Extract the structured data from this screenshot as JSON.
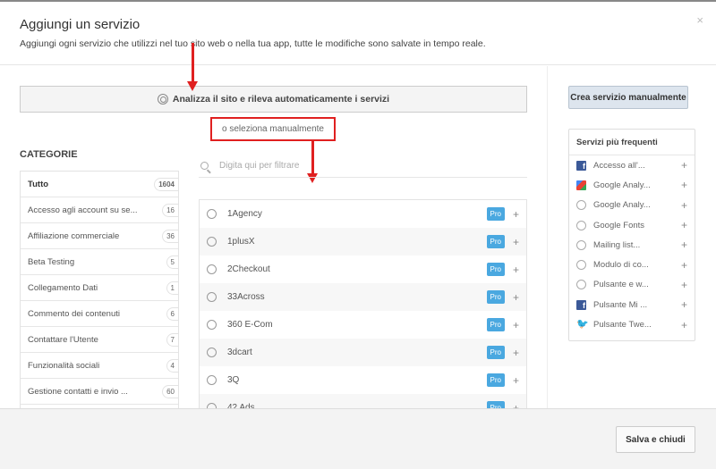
{
  "header": {
    "title": "Aggiungi un servizio",
    "subtitle": "Aggiungi ogni servizio che utilizzi nel tuo sito web o nella tua app, tutte le modifiche sono salvate in tempo reale.",
    "close": "×"
  },
  "analyze_label": "Analizza il sito e rileva automaticamente i servizi",
  "manual_label": "o seleziona manualmente",
  "categories": {
    "label": "CATEGORIE",
    "items": [
      {
        "label": "Tutto",
        "count": "1604"
      },
      {
        "label": "Accesso agli account su se...",
        "count": "16"
      },
      {
        "label": "Affiliazione commerciale",
        "count": "36"
      },
      {
        "label": "Beta Testing",
        "count": "5"
      },
      {
        "label": "Collegamento Dati",
        "count": "1"
      },
      {
        "label": "Commento dei contenuti",
        "count": "6"
      },
      {
        "label": "Contattare l'Utente",
        "count": "7"
      },
      {
        "label": "Funzionalità sociali",
        "count": "4"
      },
      {
        "label": "Gestione contatti e invio ...",
        "count": "60"
      }
    ]
  },
  "search": {
    "placeholder": "Digita qui per filtrare"
  },
  "services": {
    "badge": "Pro",
    "add": "+",
    "items": [
      "1Agency",
      "1plusX",
      "2Checkout",
      "33Across",
      "360 E-Com",
      "3dcart",
      "3Q",
      "42 Ads"
    ]
  },
  "create_label": "Crea servizio manualmente",
  "frequent": {
    "title": "Servizi più frequenti",
    "items": [
      {
        "label": "Accesso all'...",
        "icon": "facebook"
      },
      {
        "label": "Google Analy...",
        "icon": "google"
      },
      {
        "label": "Google Analy...",
        "icon": "globe"
      },
      {
        "label": "Google Fonts",
        "icon": "globe"
      },
      {
        "label": "Mailing list...",
        "icon": "globe"
      },
      {
        "label": "Modulo di co...",
        "icon": "globe"
      },
      {
        "label": "Pulsante e w...",
        "icon": "globe"
      },
      {
        "label": "Pulsante Mi ...",
        "icon": "facebook"
      },
      {
        "label": "Pulsante Twe...",
        "icon": "twitter"
      }
    ]
  },
  "footer": {
    "save_label": "Salva e chiudi"
  },
  "colors": {
    "annotation": "#e02020",
    "pro_badge": "#4aa8e0"
  }
}
